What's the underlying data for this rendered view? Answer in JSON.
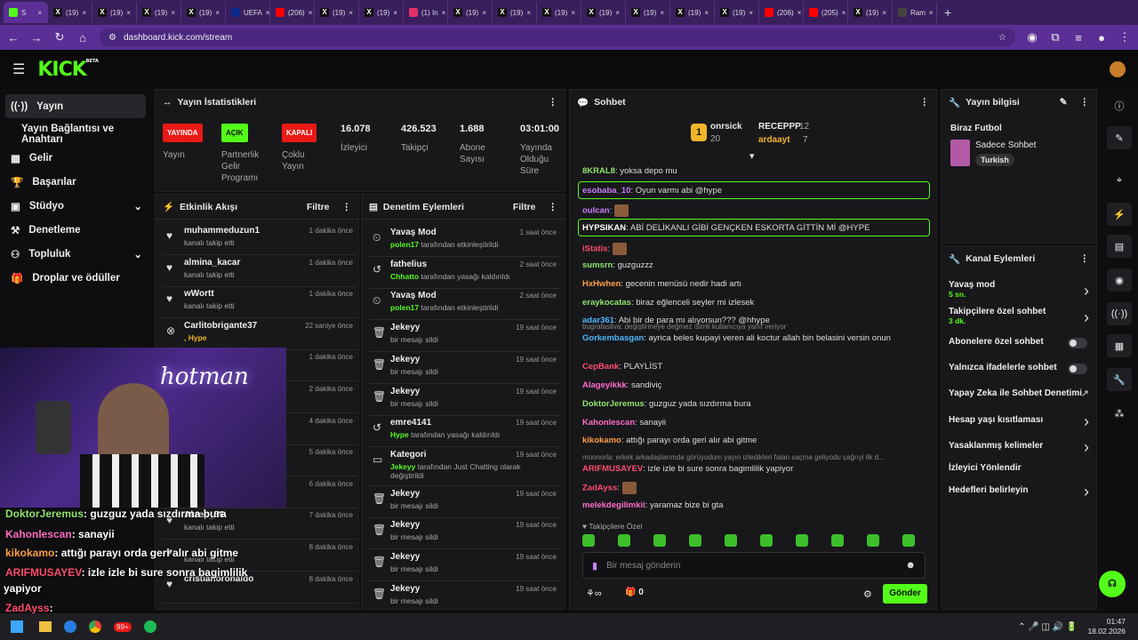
{
  "browser": {
    "tabs": [
      "S",
      "(19)",
      "(19)",
      "(19)",
      "(19)",
      "UEFA",
      "(206)",
      "(19)",
      "(19)",
      "(1) In",
      "(19)",
      "(19)",
      "(19)",
      "(19)",
      "(19)",
      "(19)",
      "(19)",
      "(206)",
      "(205)",
      "(19)",
      "Ram"
    ],
    "url": "dashboard.kick.com/stream"
  },
  "kick": {
    "logo": "KICK",
    "beta": "BETA"
  },
  "sidebar": {
    "items": [
      {
        "label": "Yayın",
        "icon": "stream-icon"
      },
      {
        "label": "Yayın Bağlantısı ve Anahtarı"
      },
      {
        "label": "Gelir",
        "icon": "revenue-icon"
      },
      {
        "label": "Başarılar",
        "icon": "trophy-icon"
      },
      {
        "label": "Stüdyo",
        "icon": "studio-icon"
      },
      {
        "label": "Denetleme",
        "icon": "moderation-icon"
      },
      {
        "label": "Topluluk",
        "icon": "community-icon"
      },
      {
        "label": "Droplar ve ödüller",
        "icon": "gift-icon"
      }
    ]
  },
  "stats": {
    "title": "Yayın İstatistikleri",
    "live_badge": "YAYINDA",
    "live_label": "Yayın",
    "partner_badge": "AÇIK",
    "partner_label": "Partnerlik Gelir Programı",
    "multi_badge": "KAPALI",
    "multi_label": "Çoklu Yayın",
    "viewers": "16.078",
    "viewers_label": "İzleyici",
    "followers": "426.523",
    "followers_label": "Takipçi",
    "subs": "1.688",
    "subs_label": "Abone Sayısı",
    "uptime": "03:01:00",
    "uptime_label": "Yayında Olduğu Süre"
  },
  "activity": {
    "title": "Etkinlik Akışı",
    "filter": "Filtre",
    "rows": [
      {
        "name": "muhammeduzun1",
        "sub": "kanalı takip etti",
        "time": "1 dakika önce"
      },
      {
        "name": "almina_kacar",
        "sub": "kanalı takip etti",
        "time": "1 dakika önce"
      },
      {
        "name": "wWortt",
        "sub": "kanalı takip etti",
        "time": "1 dakika önce"
      },
      {
        "name": "Carlitobrigante37",
        "sub": ", Hype",
        "time": "22 saniye önce"
      },
      {
        "name": "",
        "sub": "",
        "time": "1 dakika önce"
      },
      {
        "name": "",
        "sub": "",
        "time": "2 dakika önce"
      },
      {
        "name": "",
        "sub": "",
        "time": "4 dakika önce"
      },
      {
        "name": "",
        "sub": "",
        "time": "5 dakika önce"
      },
      {
        "name": "",
        "sub": "kanalı takip etti",
        "time": "6 dakika önce"
      },
      {
        "name": "Akrep_56",
        "sub": "kanalı takip etti",
        "time": "7 dakika önce"
      },
      {
        "name": "",
        "sub": "kanalı takip etti",
        "time": "8 dakika önce"
      },
      {
        "name": "cristianoronaldo",
        "sub": "",
        "time": "8 dakika önce"
      }
    ]
  },
  "modlog": {
    "title": "Denetim Eylemleri",
    "filter": "Filtre",
    "rows": [
      {
        "name": "Yavaş Mod",
        "sub_user": "polen17",
        "sub": "tarafından etkinleştirildi",
        "time": "1 saat önce"
      },
      {
        "name": "fathelius",
        "sub_user": "Chhatto",
        "sub": "tarafından yasağı kaldırıldı",
        "time": "2 saat önce"
      },
      {
        "name": "Yavaş Mod",
        "sub_user": "polen17",
        "sub": "tarafından etkinleştirildi",
        "time": "2 saat önce"
      },
      {
        "name": "Jekeyy",
        "sub_user": "",
        "sub": "bir mesajı sildi",
        "time": "19 saat önce"
      },
      {
        "name": "Jekeyy",
        "sub_user": "",
        "sub": "bir mesajı sildi",
        "time": "19 saat önce"
      },
      {
        "name": "Jekeyy",
        "sub_user": "",
        "sub": "bir mesajı sildi",
        "time": "19 saat önce"
      },
      {
        "name": "emre4141",
        "sub_user": "Hype",
        "sub": "tarafından yasağı kaldırıldı",
        "time": "19 saat önce"
      },
      {
        "name": "Kategori",
        "sub_user": "Jekeyy",
        "sub": "tarafından Just Chatting olarak değiştirildi",
        "time": "19 saat önce"
      },
      {
        "name": "Jekeyy",
        "sub_user": "",
        "sub": "bir mesajı sildi",
        "time": "19 saat önce"
      },
      {
        "name": "Jekeyy",
        "sub_user": "",
        "sub": "bir mesajı sildi",
        "time": "19 saat önce"
      },
      {
        "name": "Jekeyy",
        "sub_user": "",
        "sub": "bir mesajı sildi",
        "time": "19 saat önce"
      },
      {
        "name": "Jekeyy",
        "sub_user": "",
        "sub": "bir mesajı sildi",
        "time": "19 saat önce"
      }
    ]
  },
  "chat": {
    "title": "Sohbet",
    "top": {
      "rank": "1",
      "first": "onrsick",
      "first_count": "20",
      "second": "RECEPPP",
      "second_count": "12",
      "third": "ardaayt",
      "third_count": "7"
    },
    "messages": [
      {
        "user": "8KRAL8",
        "color": "#8fe36a",
        "text": "yoksa depo mu"
      },
      {
        "user": "esobaba_10",
        "color": "#c77dff",
        "text": "Oyun varmı abi @hype",
        "hl": true
      },
      {
        "user": "oulcan",
        "color": "#c77dff",
        "text": ""
      },
      {
        "user": "HYPSIKAN",
        "color": "#ffffff",
        "text": "ABİ DELİKANLI GİBİ GENÇKEN ESKORTA GİTTİN Mİ @HYPE",
        "hl": true
      },
      {
        "user": "iStatis",
        "color": "#ff4d6d",
        "text": ""
      },
      {
        "user": "sumsrn",
        "color": "#8fe36a",
        "text": "guzguzzz"
      },
      {
        "user": "HxHwhen",
        "color": "#ff9f43",
        "text": "gecenin menüsü nedir hadi artı"
      },
      {
        "user": "eraykocatas",
        "color": "#8fe36a",
        "text": "biraz eğlenceli seyler mi izlesek"
      },
      {
        "user": "adar361",
        "color": "#4db8ff",
        "text": "Abi bir de para mı alıyorsun??? @hhype"
      },
      {
        "user": "Gorkembasgan",
        "color": "#4db8ff",
        "text": "ayrica beles kupayi veren ali koctur allah bin belasini versin onun",
        "reply": "bugrafasilva: değiştirmeye değmez isimli kullanıcıya yanıt veriyor"
      },
      {
        "user": "CepBank",
        "color": "#ff4d6d",
        "text": "PLAYLİST"
      },
      {
        "user": "Alageyikkk",
        "color": "#ff6ec7",
        "text": "sandiviç"
      },
      {
        "user": "DoktorJeremus",
        "color": "#8fe36a",
        "text": "guzguz yada sızdırma bura"
      },
      {
        "user": "Kahonlescan",
        "color": "#ff6ec7",
        "text": "sanayii"
      },
      {
        "user": "kikokamo",
        "color": "#ff9f43",
        "text": "attığı parayı orda geri alır abi gitme"
      },
      {
        "user": "ARIFMUSAYEV",
        "color": "#ff4d6d",
        "text": "izle izle bi sure sonra bagimlilik yapiyor",
        "reply": "moonorla: erkek arkadaşlarımda görüyodum yayın izledikleri falan saçma geliyodu çağrıyi ilk d..."
      },
      {
        "user": "ZadAyss",
        "color": "#ff4d6d",
        "text": ""
      },
      {
        "user": "melekdegilimkii",
        "color": "#ff6ec7",
        "text": "yaramaz bize bi gta"
      }
    ],
    "followers_only": "Takipçilere Özel",
    "input_placeholder": "Bir mesaj gönderin",
    "count": "0",
    "send": "Gönder"
  },
  "stream_info": {
    "title": "Yayın bilgisi",
    "stream_title": "Biraz Futbol",
    "category": "Sadece Sohbet",
    "tag": "Turkish"
  },
  "channel_actions": {
    "title": "Kanal Eylemleri",
    "rows": [
      {
        "label": "Yavaş mod",
        "sub": "5 sn.",
        "type": "chevron"
      },
      {
        "label": "Takipçilere özel sohbet",
        "sub": "3 dk.",
        "type": "chevron"
      },
      {
        "label": "Abonelere özel sohbet",
        "sub": "",
        "type": "toggle"
      },
      {
        "label": "Yalnızca ifadelerle sohbet",
        "sub": "",
        "type": "toggle"
      },
      {
        "label": "Yapay Zeka ile Sohbet Denetimi",
        "sub": "",
        "type": "external"
      },
      {
        "label": "Hesap yaşı kısıtlaması",
        "sub": "",
        "type": "chevron"
      },
      {
        "label": "Yasaklanmış kelimeler",
        "sub": "",
        "type": "chevron"
      },
      {
        "label": "İzleyici Yönlendir",
        "sub": "",
        "type": "none"
      },
      {
        "label": "Hedefleri belirleyin",
        "sub": "",
        "type": "chevron"
      }
    ]
  },
  "overlay_chat": [
    {
      "user": "DoktorJeremus",
      "color": "#8fe36a",
      "text": ": guzguz yada sızdırma bura"
    },
    {
      "user": "Kahonlescan",
      "color": "#ff6ec7",
      "text": ": sanayii"
    },
    {
      "user": "kikokamo",
      "color": "#ff9f43",
      "text": ": attığı parayı orda geri alır abi gitme"
    },
    {
      "user": "ARIFMUSAYEV",
      "color": "#ff4d6d",
      "text": ": izle izle bi sure sonra bagimlilik"
    },
    {
      "user": "",
      "color": "#ffffff",
      "text": "yapiyor"
    },
    {
      "user": "ZadAyss",
      "color": "#ff4d6d",
      "text": ":"
    },
    {
      "user": "melekdegilimkii",
      "color": "#ff6ec7",
      "text": ": yaramaz bize bi gta"
    }
  ],
  "webcam": {
    "brand": "hotman"
  },
  "taskbar": {
    "time": "01:47",
    "date": "18.02.2026",
    "badge": "99+"
  },
  "colors": {
    "accent": "#53fc18",
    "live": "#e91916",
    "panel": "#18181b"
  }
}
